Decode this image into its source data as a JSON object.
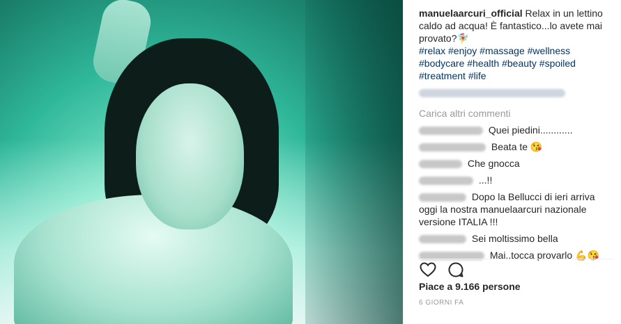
{
  "post": {
    "username": "manuelaarcuri_official",
    "caption_text": " Relax in un lettino caldo ad acqua! È fantastico...lo avete mai provato?🧚‍♀",
    "hashtags": "#relax #enjoy #massage #wellness #bodycare #health #beauty #spoiled #treatment #life",
    "load_more": "Carica altri commenti",
    "likes": "Piace a 9.166 persone",
    "time": "6 GIORNI FA"
  },
  "comments": [
    {
      "text": " Quei piedini............"
    },
    {
      "text": " Beata te 😘"
    },
    {
      "text": " Che gnocca"
    },
    {
      "text": " ...!!"
    },
    {
      "text": " Dopo la Bellucci di ieri arriva oggi la nostra manuelaarcuri nazionale versione ITALIA !!!"
    },
    {
      "text": " Sei moltissimo bella"
    },
    {
      "text": " Mai..tocca provarlo 💪😘"
    }
  ],
  "icons": {
    "like": "heart-icon",
    "comment": "comment-icon"
  }
}
